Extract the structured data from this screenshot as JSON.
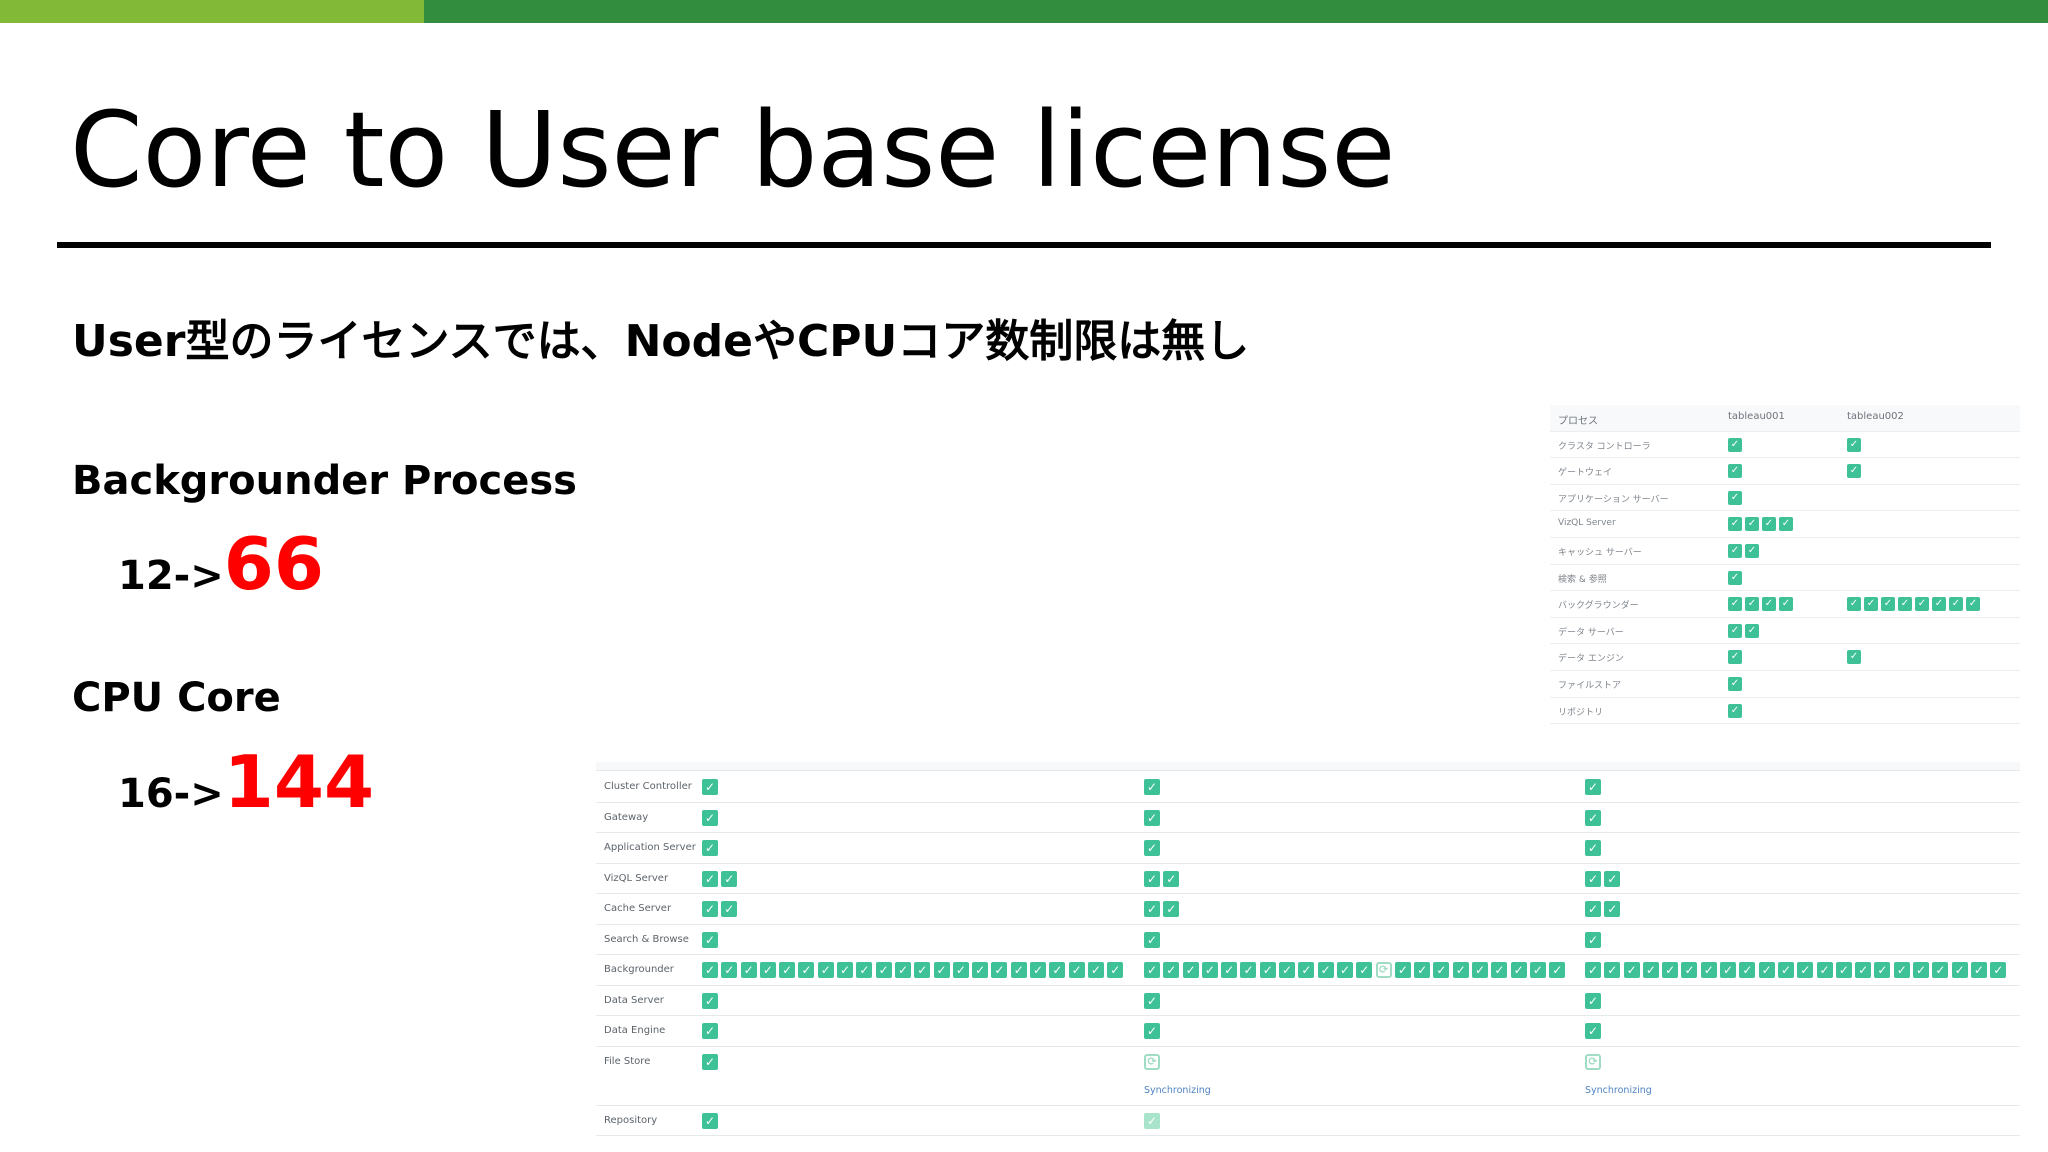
{
  "slide": {
    "title": "Core to User base license",
    "subtitle": "User型のライセンスでは、NodeやCPUコア数制限は無し",
    "metrics": [
      {
        "label": "Backgrounder Process",
        "old": "12->",
        "new": "66"
      },
      {
        "label": "CPU Core",
        "old": "16->",
        "new": "144"
      }
    ],
    "colors": {
      "accent_light": "#82b936",
      "accent_dark": "#338d3e",
      "highlight": "#ff0000",
      "check": "#3ec196",
      "link": "#4f84c4"
    }
  },
  "ja_table": {
    "headers": [
      "プロセス",
      "tableau001",
      "tableau002"
    ],
    "rows": [
      {
        "name": "クラスタ コントローラ",
        "n1": 1,
        "n2": 1
      },
      {
        "name": "ゲートウェイ",
        "n1": 1,
        "n2": 1
      },
      {
        "name": "アプリケーション サーバー",
        "n1": 1,
        "n2": 0
      },
      {
        "name": "VizQL Server",
        "n1": 4,
        "n2": 0
      },
      {
        "name": "キャッシュ サーバー",
        "n1": 2,
        "n2": 0
      },
      {
        "name": "検索 & 参照",
        "n1": 1,
        "n2": 0
      },
      {
        "name": "バックグラウンダー",
        "n1": 4,
        "n2": 8
      },
      {
        "name": "データ サーバー",
        "n1": 2,
        "n2": 0
      },
      {
        "name": "データ エンジン",
        "n1": 1,
        "n2": 1
      },
      {
        "name": "ファイルストア",
        "n1": 1,
        "n2": 0
      },
      {
        "name": "リポジトリ",
        "n1": 1,
        "n2": 0
      }
    ]
  },
  "en_table": {
    "sync_label": "Synchronizing",
    "rows": [
      {
        "name": "Cluster Controller",
        "cells": [
          [
            1,
            "ok"
          ],
          [
            1,
            "ok"
          ],
          [
            1,
            "ok"
          ]
        ]
      },
      {
        "name": "Gateway",
        "cells": [
          [
            1,
            "ok"
          ],
          [
            1,
            "ok"
          ],
          [
            1,
            "ok"
          ]
        ]
      },
      {
        "name": "Application Server",
        "cells": [
          [
            1,
            "ok"
          ],
          [
            1,
            "ok"
          ],
          [
            1,
            "ok"
          ]
        ]
      },
      {
        "name": "VizQL Server",
        "cells": [
          [
            2,
            "ok"
          ],
          [
            2,
            "ok"
          ],
          [
            2,
            "ok"
          ]
        ]
      },
      {
        "name": "Cache Server",
        "cells": [
          [
            2,
            "ok"
          ],
          [
            2,
            "ok"
          ],
          [
            2,
            "ok"
          ]
        ]
      },
      {
        "name": "Search & Browse",
        "cells": [
          [
            1,
            "ok"
          ],
          [
            1,
            "ok"
          ],
          [
            1,
            "ok"
          ]
        ]
      },
      {
        "name": "Backgrounder",
        "cells": [
          [
            22,
            "ok"
          ],
          [
            22,
            "bg"
          ],
          [
            22,
            "ok"
          ]
        ]
      },
      {
        "name": "Data Server",
        "cells": [
          [
            1,
            "ok"
          ],
          [
            1,
            "ok"
          ],
          [
            1,
            "ok"
          ]
        ]
      },
      {
        "name": "Data Engine",
        "cells": [
          [
            1,
            "ok"
          ],
          [
            1,
            "ok"
          ],
          [
            1,
            "ok"
          ]
        ]
      },
      {
        "name": "File Store",
        "cells": [
          [
            1,
            "ok"
          ],
          [
            1,
            "sync"
          ],
          [
            1,
            "sync"
          ]
        ]
      },
      {
        "name": "Repository",
        "cells": [
          [
            1,
            "ok"
          ],
          [
            1,
            "light"
          ],
          [
            0,
            "ok"
          ]
        ]
      }
    ]
  }
}
